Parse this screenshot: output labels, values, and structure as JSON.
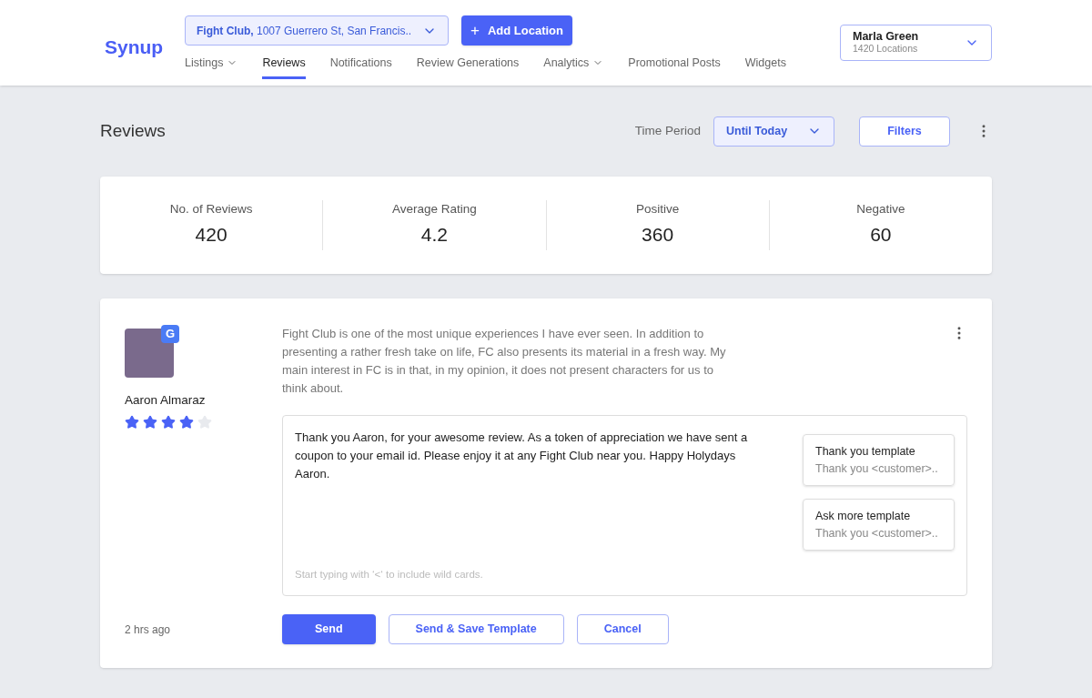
{
  "logo": "Synup",
  "location_selector": {
    "value": "**Fight Club,** 1007 Guerrero St, San Francis.."
  },
  "add_location_button": {
    "icon": "+",
    "label": "Add Location"
  },
  "nav": [
    {
      "label": "Listings",
      "has_menu": true,
      "selected": false
    },
    {
      "label": "Reviews",
      "has_menu": false,
      "selected": true
    },
    {
      "label": "Notifications",
      "has_menu": false,
      "selected": false
    },
    {
      "label": "Review Generations",
      "has_menu": false,
      "selected": false
    },
    {
      "label": "Analytics",
      "has_menu": true,
      "selected": false
    },
    {
      "label": "Promotional Posts",
      "has_menu": false,
      "selected": false
    },
    {
      "label": "Widgets",
      "has_menu": false,
      "selected": false
    }
  ],
  "account": {
    "name": "Marla Green",
    "subtitle": "1420 Locations"
  },
  "page_title": "Reviews",
  "time_period": {
    "label": "Time Period",
    "value": "Until Today"
  },
  "filters_button": "Filters",
  "stats": [
    {
      "label": "No. of Reviews",
      "value": "420"
    },
    {
      "label": "Average Rating",
      "value": "4.2"
    },
    {
      "label": "Positive",
      "value": "360"
    },
    {
      "label": "Negative",
      "value": "60"
    }
  ],
  "review": {
    "source_badge": "G",
    "author": "Aaron Almaraz",
    "stars": 4,
    "time": "2 hrs ago",
    "text": "Fight Club is one of the most unique experiences I have ever seen. In addition to presenting a rather fresh take on life, FC also presents its material in a fresh way. My main interest in FC is in that, in my opinion, it does not present characters for us to think about.",
    "reply": {
      "value": "Thank you Aaron, for your awesome review. As a token of appreciation we have sent a coupon to your email id. Please enjoy it at any Fight Club near you. Happy Holydays Aaron.",
      "hint": "Start typing with ‘<‘ to include wild cards.",
      "templates": [
        {
          "title": "Thank you template",
          "preview": "Thank you <customer>.."
        },
        {
          "title": "Ask more template",
          "preview": "Thank you <customer>.."
        }
      ]
    },
    "buttons": [
      {
        "label": "Send",
        "kind": "primary"
      },
      {
        "label": "Send & Save Template",
        "kind": "outline"
      },
      {
        "label": "Cancel",
        "kind": "outline"
      }
    ]
  }
}
